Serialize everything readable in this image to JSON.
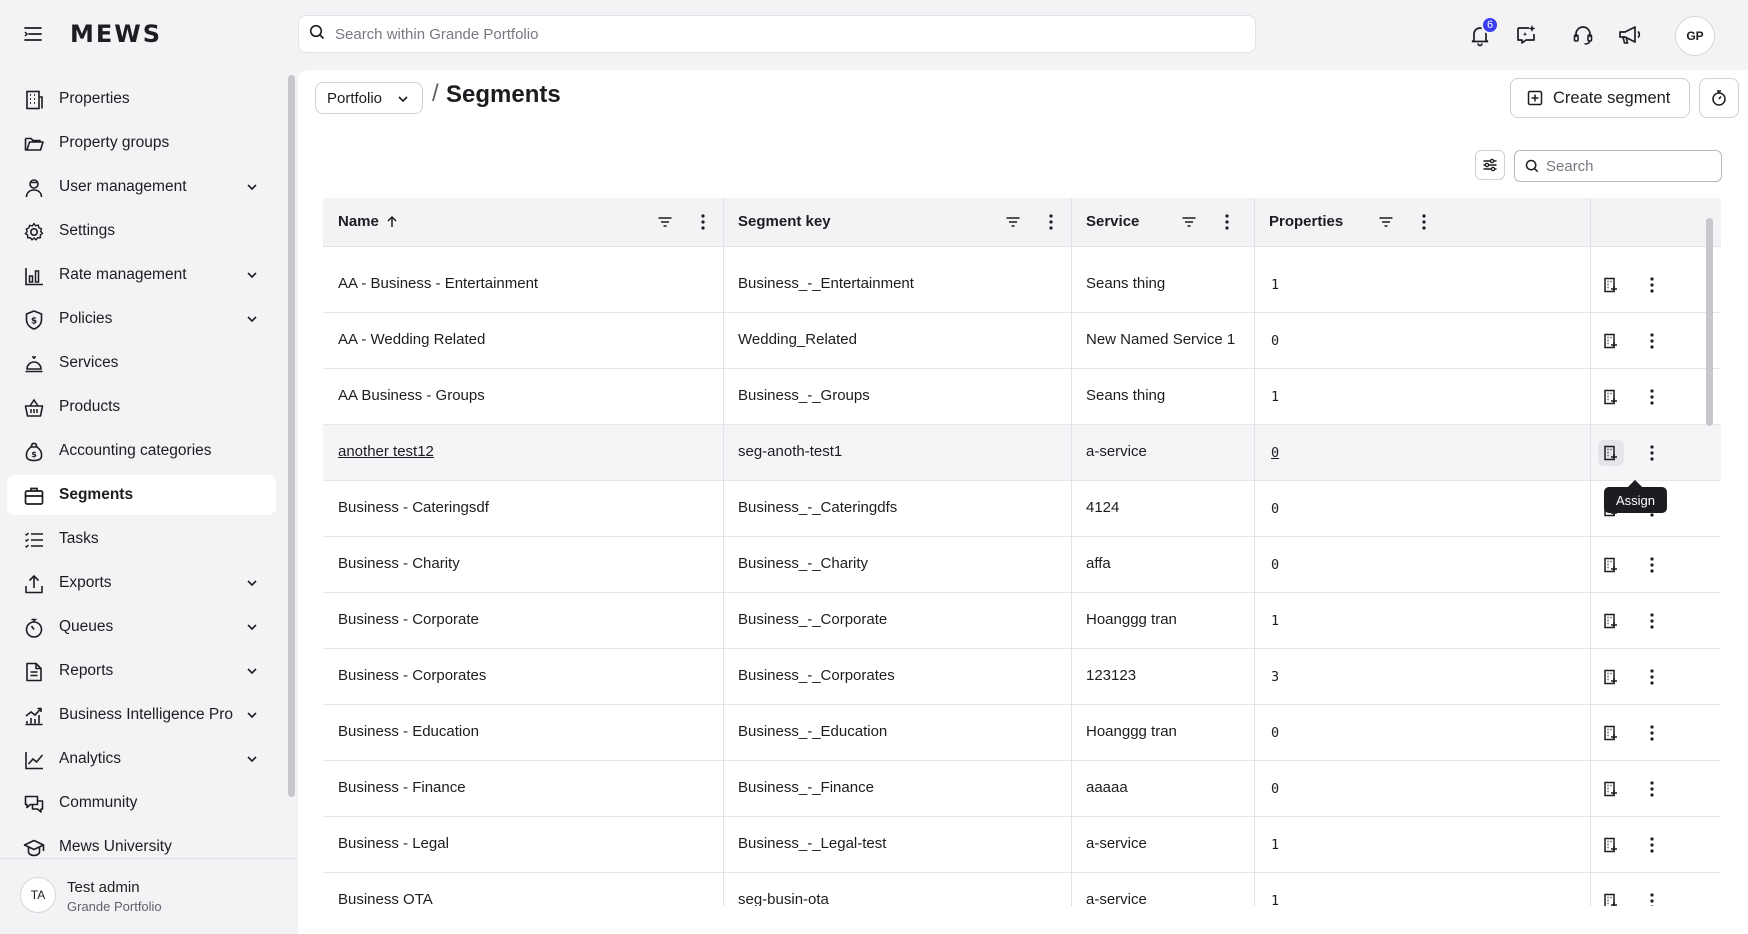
{
  "app": {
    "logo": "MEWS"
  },
  "search": {
    "placeholder": "Search within Grande Portfolio"
  },
  "header": {
    "notification_count": "6",
    "avatar_initials": "GP"
  },
  "sidebar": {
    "items": [
      {
        "label": "Properties",
        "icon": "building-icon"
      },
      {
        "label": "Property groups",
        "icon": "folder-icon"
      },
      {
        "label": "User management",
        "icon": "user-icon",
        "expandable": true
      },
      {
        "label": "Settings",
        "icon": "gear-icon"
      },
      {
        "label": "Rate management",
        "icon": "bar-chart-icon",
        "expandable": true
      },
      {
        "label": "Policies",
        "icon": "shield-dollar-icon",
        "expandable": true
      },
      {
        "label": "Services",
        "icon": "bell-service-icon"
      },
      {
        "label": "Products",
        "icon": "basket-icon"
      },
      {
        "label": "Accounting categories",
        "icon": "money-bag-icon"
      },
      {
        "label": "Segments",
        "icon": "briefcase-icon",
        "active": true
      },
      {
        "label": "Tasks",
        "icon": "list-icon"
      },
      {
        "label": "Exports",
        "icon": "upload-icon",
        "expandable": true
      },
      {
        "label": "Queues",
        "icon": "stopwatch-icon",
        "expandable": true
      },
      {
        "label": "Reports",
        "icon": "document-icon",
        "expandable": true
      },
      {
        "label": "Business Intelligence Pro",
        "icon": "trend-chart-icon",
        "expandable": true
      },
      {
        "label": "Analytics",
        "icon": "line-chart-icon",
        "expandable": true
      },
      {
        "label": "Community",
        "icon": "chat-icon"
      },
      {
        "label": "Mews University",
        "icon": "graduation-cap-icon"
      }
    ],
    "user": {
      "initials": "TA",
      "name": "Test admin",
      "org": "Grande Portfolio"
    }
  },
  "breadcrumb": {
    "parent": "Portfolio",
    "separator": "/",
    "title": "Segments"
  },
  "toolbar": {
    "create_label": "Create segment",
    "search_placeholder": "Search"
  },
  "table": {
    "columns": [
      {
        "label": "Name",
        "sort": "asc"
      },
      {
        "label": "Segment key"
      },
      {
        "label": "Service"
      },
      {
        "label": "Properties"
      }
    ],
    "rows": [
      {
        "name": "AA - Business - Entertainment",
        "key": "Business_-_Entertainment",
        "service": "Seans thing",
        "properties": "1"
      },
      {
        "name": "AA - Wedding Related",
        "key": "Wedding_Related",
        "service": "New Named Service 1",
        "properties": "0"
      },
      {
        "name": "AA Business - Groups",
        "key": "Business_-_Groups",
        "service": "Seans thing",
        "properties": "1"
      },
      {
        "name": "another test12",
        "key": "seg-anoth-test1",
        "service": "a-service",
        "properties": "0",
        "hover": true
      },
      {
        "name": "Business - Cateringsdf",
        "key": "Business_-_Cateringdfs",
        "service": "4124",
        "properties": "0"
      },
      {
        "name": "Business - Charity",
        "key": "Business_-_Charity",
        "service": "affa",
        "properties": "0"
      },
      {
        "name": "Business - Corporate",
        "key": "Business_-_Corporate",
        "service": "Hoanggg tran",
        "properties": "1"
      },
      {
        "name": "Business - Corporates",
        "key": "Business_-_Corporates",
        "service": "123123",
        "properties": "3"
      },
      {
        "name": "Business - Education",
        "key": "Business_-_Education",
        "service": "Hoanggg tran",
        "properties": "0"
      },
      {
        "name": "Business - Finance",
        "key": "Business_-_Finance",
        "service": "aaaaa",
        "properties": "0"
      },
      {
        "name": "Business - Legal",
        "key": "Business_-_Legal-test",
        "service": "a-service",
        "properties": "1"
      },
      {
        "name": "Business OTA",
        "key": "seg-busin-ota",
        "service": "a-service",
        "properties": "1"
      }
    ],
    "tooltip": "Assign"
  },
  "colors": {
    "accent": "#3a3ef0",
    "sidebar_bg": "#f3f3f5",
    "surface": "#ffffff",
    "text": "#1c1d20"
  }
}
